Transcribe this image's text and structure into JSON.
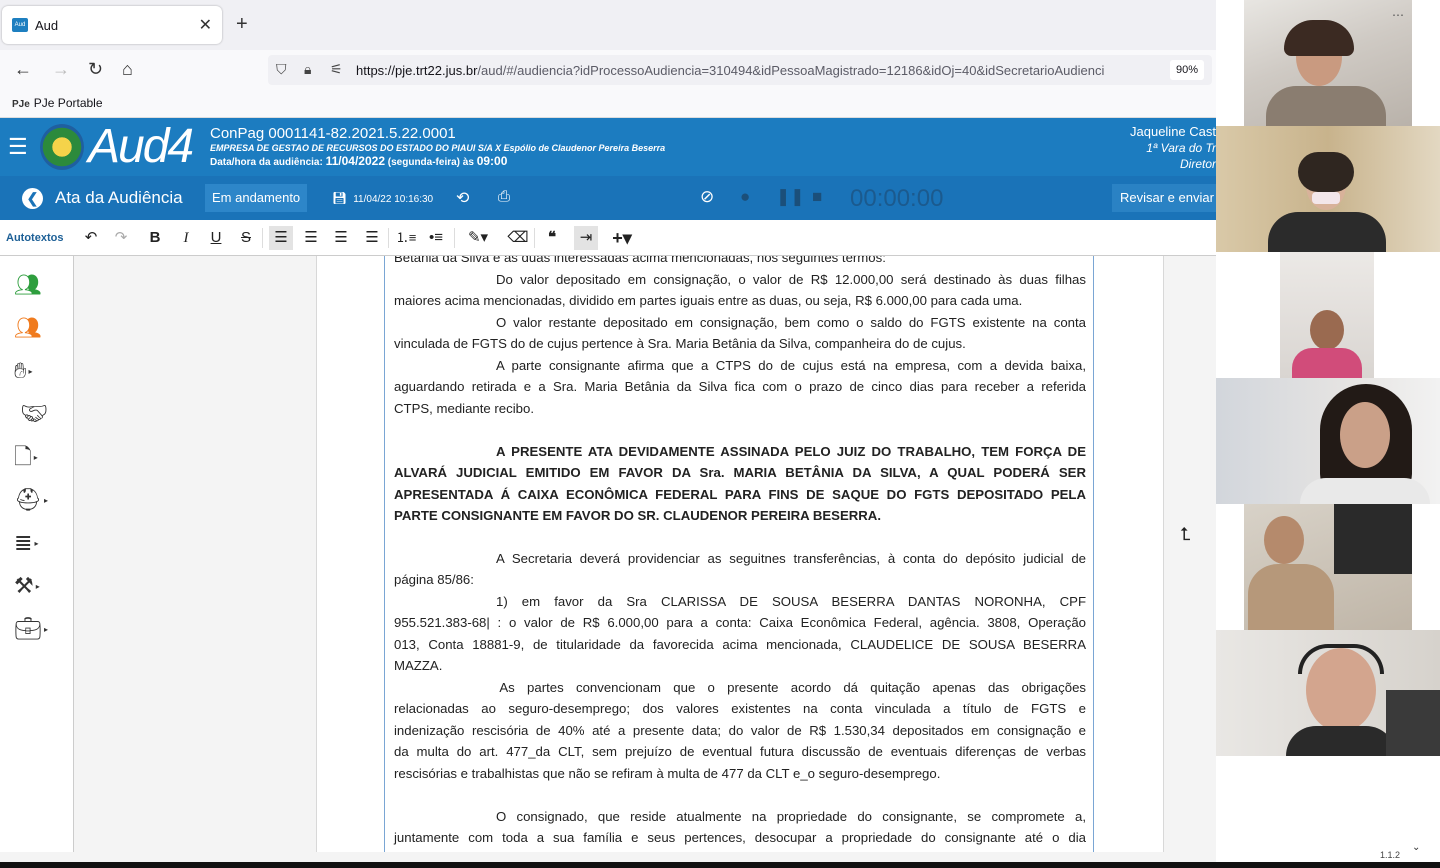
{
  "browser": {
    "tab_title": "Aud",
    "tab_favicon": "Aud",
    "url_domain": "https://pje.trt22.jus.br",
    "url_path": "/aud/#/audiencia?idProcessoAudiencia=310494&idPessoaMagistrado=12186&idOj=40&idSecretarioAudienci",
    "zoom": "90%",
    "bookmark": "PJe Portable",
    "bookmark_prefix": "PJe"
  },
  "header": {
    "logo": "Aud4",
    "process": "ConPag 0001141-82.2021.5.22.0001",
    "parties": "EMPRESA DE GESTAO DE RECURSOS DO ESTADO DO PIAUI S/A X Espólio de Claudenor Pereira Beserra",
    "datetime_label": "Data/hora da audiência:",
    "datetime_value": "11/04/2022",
    "weekday": "(segunda-feira) às",
    "time": "09:00",
    "user_name": "Jaqueline Cast",
    "user_unit": "1ª Vara do Tr",
    "user_role": "Diretor"
  },
  "ata_bar": {
    "title": "Ata da Audiência",
    "status": "Em andamento",
    "saved_at": "11/04/22 10:16:30",
    "timer": "00:00:00",
    "review_button": "Revisar e enviar i"
  },
  "editor_toolbar": {
    "autotextos": "Autotextos"
  },
  "document": {
    "lines": [
      "Betânia da Silva e às duas interessadas acima mencionadas, nos seguintes termos:",
      "                              Do valor depositado em consignação, o valor de R$ 12.000,00 será destinado às duas filhas",
      "maiores acima mencionadas, dividido em partes iguais entre as duas, ou seja,  R$ 6.000,00 para cada uma.",
      "                              O valor restante depositado em consignação, bem como o saldo do FGTS existente na conta",
      "vinculada de FGTS do de cujus pertence à Sra. Maria Betânia da Silva, companheira do de cujus.",
      "                              A parte consignante afirma que a CTPS do de cujus está na empresa, com a devida baixa,",
      "aguardando retirada e a Sra. Maria Betânia da Silva fica com o prazo de cinco dias para receber a referida",
      "CTPS, mediante recibo.",
      "                              A PRESENTE ATA DEVIDAMENTE ASSINADA PELO JUIZ DO TRABALHO, TEM FORÇA DE",
      "ALVARÁ JUDICIAL EMITIDO EM FAVOR DA Sra. MARIA BETÂNIA DA SILVA, A QUAL PODERÁ SER",
      "APRESENTADA Á CAIXA ECONÔMICA FEDERAL PARA FINS DE SAQUE DO FGTS DEPOSITADO PELA",
      "PARTE CONSIGNANTE EM FAVOR DO SR. CLAUDENOR PEREIRA BESERRA.",
      "                              A Secretaria deverá providenciar as seguitnes transferências, à conta do depósito judicial de",
      "página 85/86:",
      "                              1) em favor da Sra CLARISSA DE SOUSA BESERRA DANTAS NORONHA, CPF",
      "955.521.383-68| : o valor de R$ 6.000,00 para a conta: Caixa Econômica Federal, agência. 3808, Operação",
      "013, Conta 18881-9, de titularidade da favorecida acima mencionada, CLAUDELICE DE SOUSA BESERRA",
      "MAZZA.",
      "                               As partes convencionam que o presente acordo dá quitação apenas das obrigações",
      "relacionadas ao seguro-desemprego; dos valores existentes na conta vinculada a título de FGTS e",
      "indenização rescisória de 40% até a presente data; do valor de R$ 1.530,34 depositados em consignação e",
      "da multa do art. 477_da CLT, sem prejuízo de eventual futura discussão de eventuais diferenças de verbas",
      "rescisórias e trabalhistas que não se refiram à multa de 477 da CLT e_o seguro-desemprego.",
      "                              O consignado, que reside atualmente na propriedade do consignante, se compromete a,",
      "juntamente com toda a sua família e seus pertences, desocupar a propriedade do consignante até o dia"
    ]
  },
  "footer": {
    "version": "1.1.2"
  },
  "colors": {
    "header_blue": "#1c7cc0",
    "bar_blue": "#1a73b8",
    "team_green": "#2e9e3e",
    "team_orange": "#f07b1e"
  }
}
